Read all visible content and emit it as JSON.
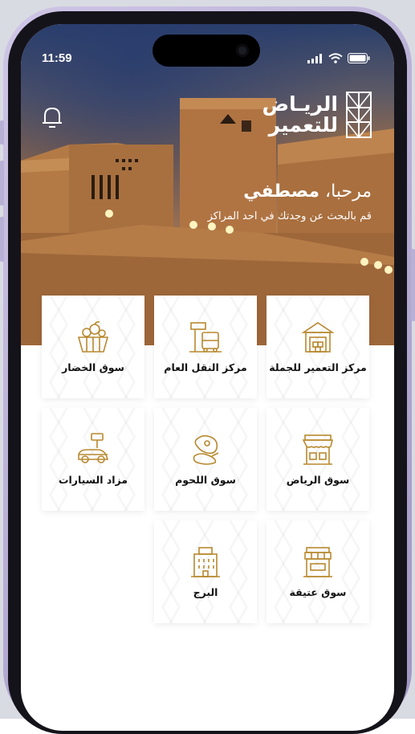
{
  "status_bar": {
    "time": "11:59"
  },
  "header": {
    "logo_line1": "الريـاض",
    "logo_line2": "للتعمير",
    "greeting_prefix": "مرحبا، ",
    "user_name": "مصطفي",
    "subtitle": "قم بالبحث عن وجدتك في احد المراكز"
  },
  "tiles": [
    {
      "label": "مركز التعمير للجملة",
      "icon": "warehouse-icon"
    },
    {
      "label": "مركز النقل العام",
      "icon": "bus-stop-icon"
    },
    {
      "label": "سوق الخضار",
      "icon": "vegetable-basket-icon"
    },
    {
      "label": "سوق الرياض",
      "icon": "market-stall-icon"
    },
    {
      "label": "سوق اللحوم",
      "icon": "meat-icon"
    },
    {
      "label": "مزاد السيارات",
      "icon": "car-auction-icon"
    },
    {
      "label": "سوق عتيقة",
      "icon": "shop-icon"
    },
    {
      "label": "البرج",
      "icon": "tower-icon"
    }
  ],
  "colors": {
    "icon_gold": "#b8892f",
    "tile_bg": "#ffffff",
    "text": "#111111"
  }
}
